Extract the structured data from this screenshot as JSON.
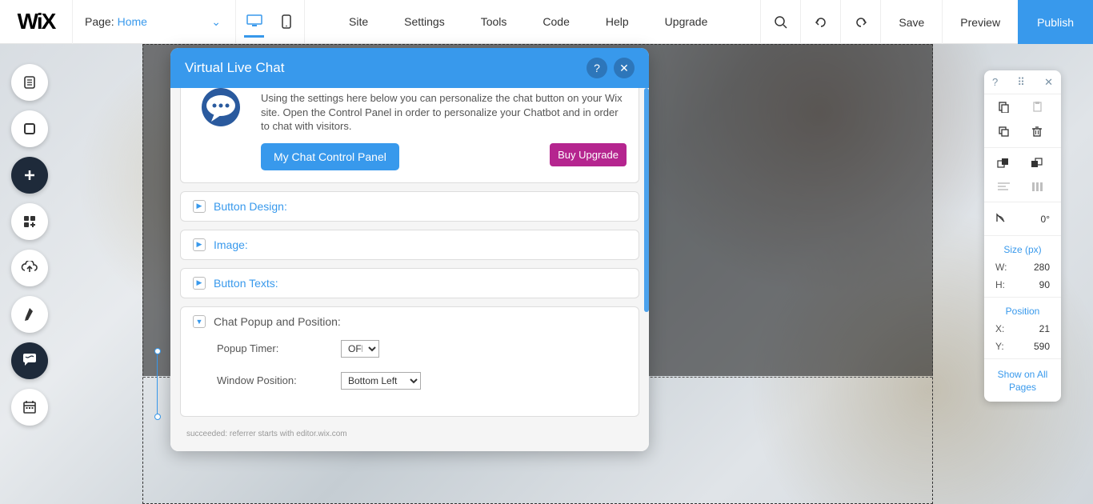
{
  "logo": "WiX",
  "page_selector": {
    "label": "Page:",
    "value": "Home"
  },
  "menu": {
    "site": "Site",
    "settings": "Settings",
    "tools": "Tools",
    "code": "Code",
    "help": "Help",
    "upgrade": "Upgrade"
  },
  "actions": {
    "save": "Save",
    "preview": "Preview",
    "publish": "Publish"
  },
  "modal": {
    "title": "Virtual Live Chat",
    "intro": "Using the settings here below you can personalize the chat button on your Wix site. Open the Control Panel in order to personalize your Chatbot and in order to chat with visitors.",
    "cp_btn": "My Chat Control Panel",
    "upgrade_btn": "Buy Upgrade",
    "sections": {
      "button_design": "Button Design:",
      "image": "Image:",
      "button_texts": "Button Texts:",
      "popup_position": "Chat Popup and Position:"
    },
    "fields": {
      "popup_timer_label": "Popup Timer:",
      "popup_timer_value": "OFF",
      "window_position_label": "Window Position:",
      "window_position_value": "Bottom Left"
    },
    "footnote": "succeeded: referrer starts with editor.wix.com"
  },
  "right_panel": {
    "angle": "0°",
    "size_label": "Size (px)",
    "w_label": "W:",
    "w_value": "280",
    "h_label": "H:",
    "h_value": "90",
    "pos_label": "Position",
    "x_label": "X:",
    "x_value": "21",
    "y_label": "Y:",
    "y_value": "590",
    "show_all": "Show on All Pages"
  }
}
